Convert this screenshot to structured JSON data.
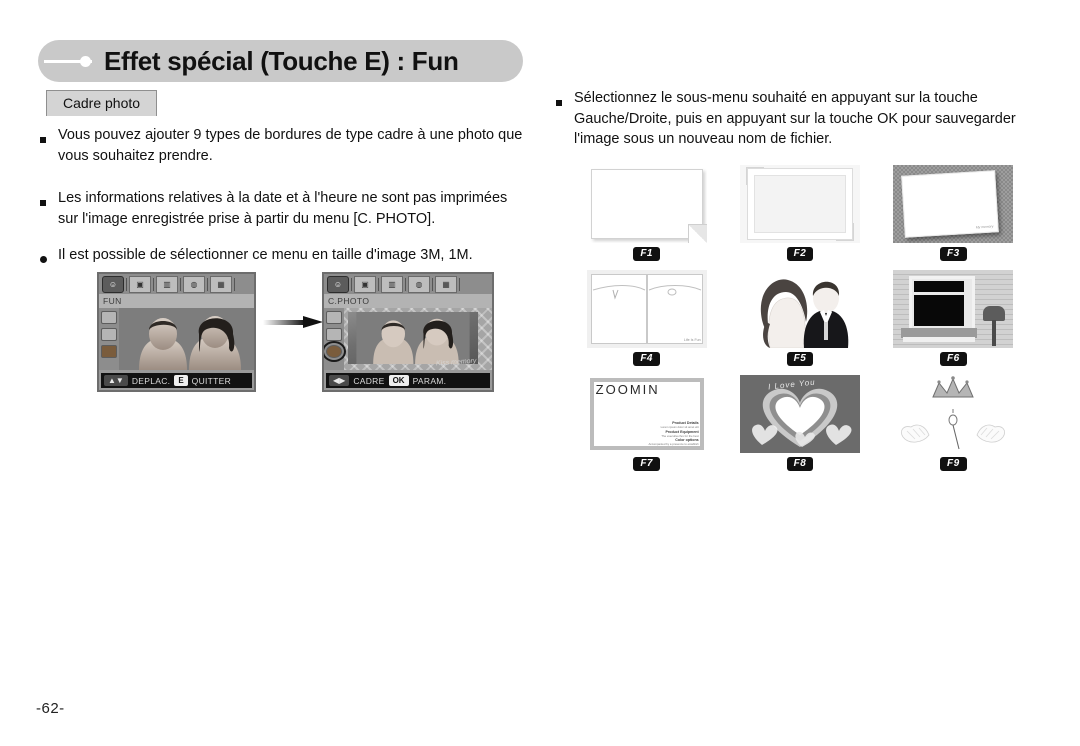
{
  "document": {
    "page_number": "-62-",
    "title": "Effet spécial (Touche E)  : Fun",
    "tab_label": "Cadre photo"
  },
  "left_column": {
    "bullets": [
      {
        "marker": "square",
        "text": "Vous pouvez ajouter 9 types de bordures de type cadre à une photo que vous souhaitez prendre."
      },
      {
        "marker": "square",
        "text": "Les informations relatives à la date et à l'heure ne sont pas imprimées sur l'image enregistrée prise à partir du menu [C. PHOTO]."
      },
      {
        "marker": "circle",
        "text": "Il est possible de sélectionner ce menu en taille d'image 3M, 1M."
      }
    ]
  },
  "right_column": {
    "bullets": [
      {
        "marker": "square",
        "text": "Sélectionnez le sous-menu souhaité en appuyant sur la touche Gauche/Droite, puis en appuyant sur la touche OK pour sauvegarder l'image sous un nouveau nom de fichier."
      }
    ]
  },
  "lcd_screens": [
    {
      "id": "lcd-before",
      "menu_title": "FUN",
      "status": {
        "left_key": "up-down-icon",
        "left_label": "DEPLAC.",
        "right_key": "E",
        "right_label": "QUITTER"
      }
    },
    {
      "id": "lcd-after",
      "menu_title": "C.PHOTO",
      "watermark": "Kiss memory",
      "status": {
        "left_key": "left-right-icon",
        "left_label": "CADRE",
        "right_key": "OK",
        "right_label": "PARAM."
      }
    }
  ],
  "frames": [
    {
      "label": "F1",
      "kind": "folded-sheet",
      "caption": ""
    },
    {
      "label": "F2",
      "kind": "white-border",
      "caption": ""
    },
    {
      "label": "F3",
      "kind": "tilted-polaroid",
      "caption": "My memory"
    },
    {
      "label": "F4",
      "kind": "open-book",
      "caption": "Life Is Fun"
    },
    {
      "label": "F5",
      "kind": "couple-silhouette",
      "caption": ""
    },
    {
      "label": "F6",
      "kind": "house-window",
      "caption": ""
    },
    {
      "label": "F7",
      "kind": "zoomin-card",
      "caption": "ZOOMIN"
    },
    {
      "label": "F8",
      "kind": "heart",
      "caption": "I Love You"
    },
    {
      "label": "F9",
      "kind": "crown-wings",
      "caption": ""
    }
  ],
  "f7_fine_print": [
    {
      "head": "Product Details",
      "sub": "Lorem ipsum dolor sit amet elit"
    },
    {
      "head": "Product Equipment",
      "sub": "The executive flex for the best"
    },
    {
      "head": "Color options",
      "sub": "Accompanied by a presence to establish"
    }
  ],
  "colors": {
    "title_bar": "#c9c9c9",
    "chip": "#d4d4d4",
    "label_badge": "#111111",
    "lcd_bezel": "#6d6d6d"
  }
}
